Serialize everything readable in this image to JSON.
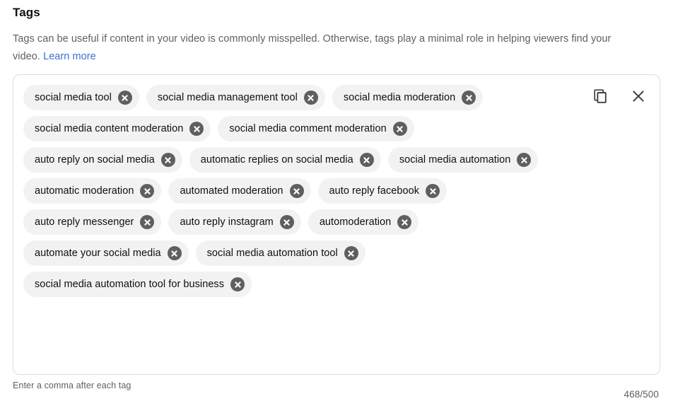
{
  "section": {
    "title": "Tags",
    "description_prefix": "Tags can be useful if content in your video is commonly misspelled. Otherwise, tags play a minimal role in helping viewers find your video. ",
    "learn_more_label": "Learn more"
  },
  "tag_box": {
    "actions": {
      "copy_label": "copy-tags",
      "close_label": "clear-tags"
    },
    "tags": [
      {
        "label": "social media tool"
      },
      {
        "label": "social media management tool"
      },
      {
        "label": "social media moderation"
      },
      {
        "label": "social media content moderation"
      },
      {
        "label": "social media comment moderation"
      },
      {
        "label": "auto reply on social media"
      },
      {
        "label": "automatic replies on social media"
      },
      {
        "label": "social media automation"
      },
      {
        "label": "automatic moderation"
      },
      {
        "label": "automated moderation"
      },
      {
        "label": "auto reply facebook"
      },
      {
        "label": "auto reply messenger"
      },
      {
        "label": "auto reply instagram"
      },
      {
        "label": "automoderation"
      },
      {
        "label": "automate your social media"
      },
      {
        "label": "social media automation tool"
      },
      {
        "label": "social media automation tool for business"
      }
    ]
  },
  "footer": {
    "hint": "Enter a comma after each tag",
    "counter": "468/500"
  },
  "colors": {
    "link": "#3b6fd4",
    "chip_bg": "#f2f2f2",
    "chip_remove_bg": "#5f5f5f",
    "text_secondary": "#606060",
    "border": "#dcdcdc"
  }
}
